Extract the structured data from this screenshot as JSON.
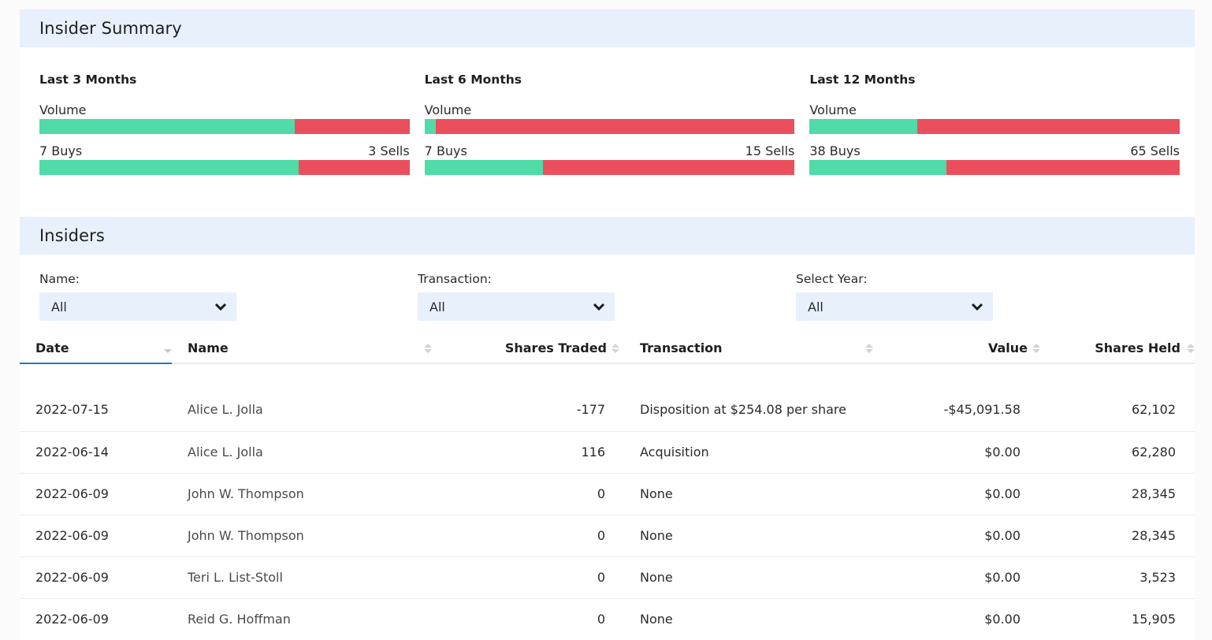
{
  "summary": {
    "title": "Insider Summary",
    "periods": [
      {
        "title": "Last 3 Months",
        "volume_label": "Volume",
        "volume_buy_fraction": 0.69,
        "buys_label": "7 Buys",
        "sells_label": "3 Sells",
        "count_buy_fraction": 0.7
      },
      {
        "title": "Last 6 Months",
        "volume_label": "Volume",
        "volume_buy_fraction": 0.03,
        "buys_label": "7 Buys",
        "sells_label": "15 Sells",
        "count_buy_fraction": 0.32
      },
      {
        "title": "Last 12 Months",
        "volume_label": "Volume",
        "volume_buy_fraction": 0.29,
        "buys_label": "38 Buys",
        "sells_label": "65 Sells",
        "count_buy_fraction": 0.37
      }
    ],
    "colors": {
      "buy": "#50dba8",
      "sell": "#eb4f5d"
    }
  },
  "insiders": {
    "title": "Insiders",
    "filters": [
      {
        "label": "Name:",
        "value": "All"
      },
      {
        "label": "Transaction:",
        "value": "All"
      },
      {
        "label": "Select Year:",
        "value": "All"
      }
    ],
    "columns": [
      "Date",
      "Name",
      "Shares Traded",
      "Transaction",
      "Value",
      "Shares Held"
    ],
    "sorted_column": "Date",
    "rows": [
      [
        "2022-07-15",
        "Alice L. Jolla",
        "-177",
        "Disposition at $254.08 per share",
        "-$45,091.58",
        "62,102"
      ],
      [
        "2022-06-14",
        "Alice L. Jolla",
        "116",
        "Acquisition",
        "$0.00",
        "62,280"
      ],
      [
        "2022-06-09",
        "John W. Thompson",
        "0",
        "None",
        "$0.00",
        "28,345"
      ],
      [
        "2022-06-09",
        "John W. Thompson",
        "0",
        "None",
        "$0.00",
        "28,345"
      ],
      [
        "2022-06-09",
        "Teri L. List-Stoll",
        "0",
        "None",
        "$0.00",
        "3,523"
      ],
      [
        "2022-06-09",
        "Reid G. Hoffman",
        "0",
        "None",
        "$0.00",
        "15,905"
      ]
    ]
  }
}
